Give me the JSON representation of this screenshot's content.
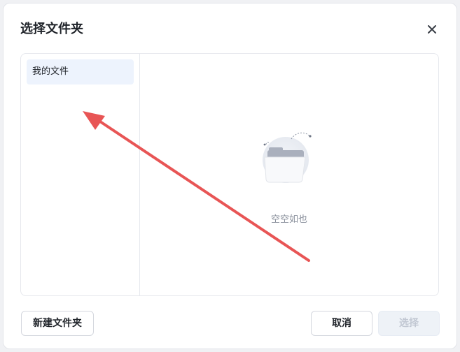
{
  "dialog": {
    "title": "选择文件夹",
    "close_icon": "close-icon"
  },
  "sidebar": {
    "items": [
      {
        "label": "我的文件",
        "selected": true
      }
    ]
  },
  "content": {
    "empty_icon": "empty-folder-icon",
    "empty_text": "空空如也"
  },
  "footer": {
    "new_folder_label": "新建文件夹",
    "cancel_label": "取消",
    "select_label": "选择",
    "select_disabled": true
  },
  "colors": {
    "selected_bg": "#edf3fd",
    "annotation_arrow": "#e85555",
    "disabled_text": "#c2c8d3"
  }
}
